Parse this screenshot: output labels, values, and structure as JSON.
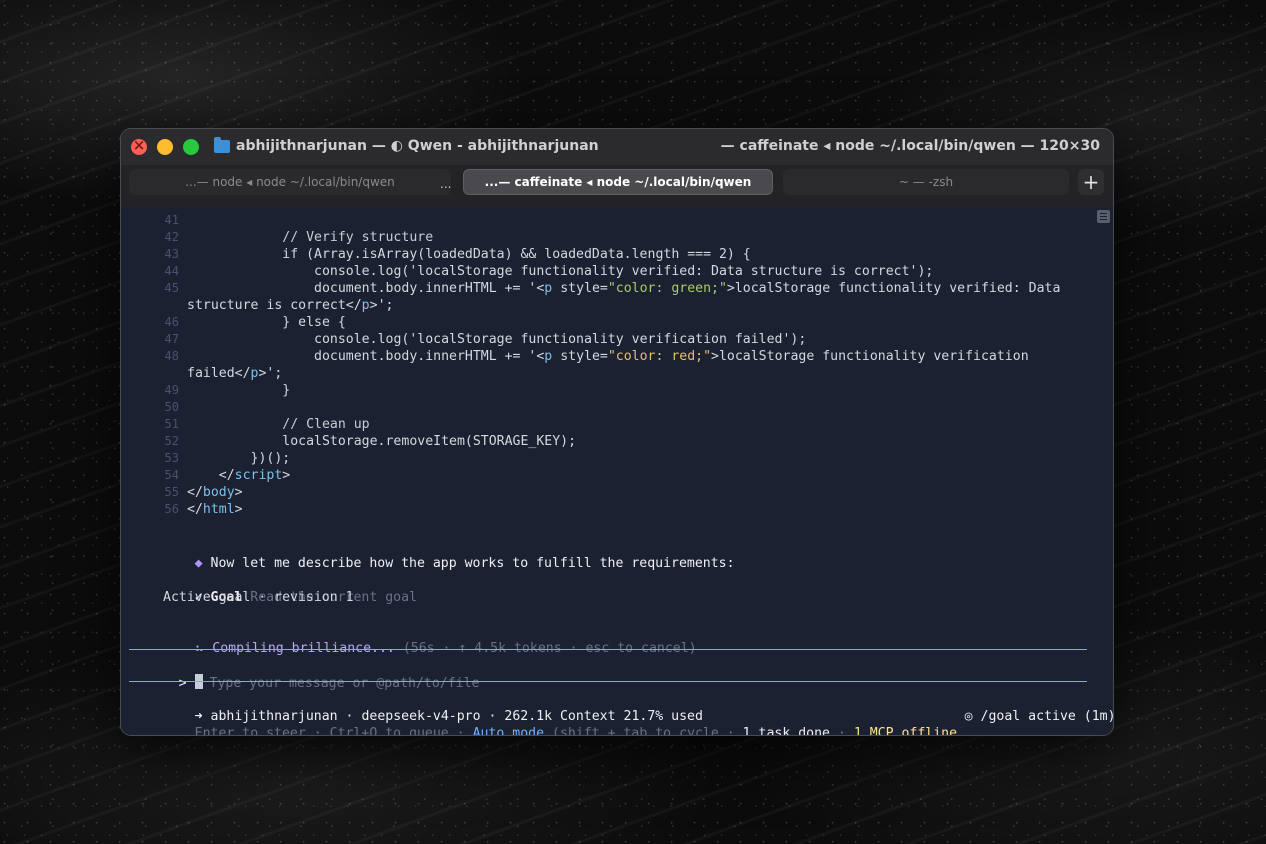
{
  "window": {
    "title_left": "abhijithnarjunan — ◐ Qwen - abhijithnarjunan",
    "title_right": "— caffeinate ◂ node ~/.local/bin/qwen — 120×30"
  },
  "tabs": [
    {
      "label": "...— node ◂ node ~/.local/bin/qwen",
      "active": false
    },
    {
      "label": "...— caffeinate ◂ node ~/.local/bin/qwen",
      "active": true
    },
    {
      "label": "~ — -zsh",
      "active": false
    }
  ],
  "tab_overflow": "...",
  "add_tab_label": "+",
  "code_lines": [
    {
      "n": "41",
      "pre": "",
      "parts": []
    },
    {
      "n": "42",
      "pre": "            ",
      "parts": [
        {
          "t": "// Verify structure",
          "c": "c-comment"
        }
      ]
    },
    {
      "n": "43",
      "pre": "            ",
      "parts": [
        {
          "t": "if (Array.isArray(loadedData) && loadedData.length === 2) {",
          "c": ""
        }
      ]
    },
    {
      "n": "44",
      "pre": "                ",
      "parts": [
        {
          "t": "console.log('localStorage functionality verified: Data structure is correct');",
          "c": ""
        }
      ]
    },
    {
      "n": "45",
      "pre": "                ",
      "parts": [
        {
          "t": "document.body.innerHTML += '<",
          "c": ""
        },
        {
          "t": "p",
          "c": "c-tag"
        },
        {
          "t": " style=",
          "c": ""
        },
        {
          "t": "\"color: green;\"",
          "c": "c-green"
        },
        {
          "t": ">localStorage functionality verified: Data",
          "c": ""
        }
      ]
    },
    {
      "n": "",
      "pre": "",
      "parts": [
        {
          "t": "structure is correct</",
          "c": ""
        },
        {
          "t": "p",
          "c": "c-tag"
        },
        {
          "t": ">';",
          "c": ""
        }
      ]
    },
    {
      "n": "46",
      "pre": "            ",
      "parts": [
        {
          "t": "} else {",
          "c": ""
        }
      ]
    },
    {
      "n": "47",
      "pre": "                ",
      "parts": [
        {
          "t": "console.log('localStorage functionality verification failed');",
          "c": ""
        }
      ]
    },
    {
      "n": "48",
      "pre": "                ",
      "parts": [
        {
          "t": "document.body.innerHTML += '<",
          "c": ""
        },
        {
          "t": "p",
          "c": "c-tag"
        },
        {
          "t": " style=",
          "c": ""
        },
        {
          "t": "\"color: red;\"",
          "c": "c-red"
        },
        {
          "t": ">localStorage functionality verification",
          "c": ""
        }
      ]
    },
    {
      "n": "",
      "pre": "",
      "parts": [
        {
          "t": "failed</",
          "c": ""
        },
        {
          "t": "p",
          "c": "c-tag"
        },
        {
          "t": ">';",
          "c": ""
        }
      ]
    },
    {
      "n": "49",
      "pre": "            ",
      "parts": [
        {
          "t": "}",
          "c": ""
        }
      ]
    },
    {
      "n": "50",
      "pre": "",
      "parts": []
    },
    {
      "n": "51",
      "pre": "            ",
      "parts": [
        {
          "t": "// Clean up",
          "c": "c-comment"
        }
      ]
    },
    {
      "n": "52",
      "pre": "            ",
      "parts": [
        {
          "t": "localStorage.removeItem(STORAGE_KEY);",
          "c": ""
        }
      ]
    },
    {
      "n": "53",
      "pre": "        ",
      "parts": [
        {
          "t": "})();",
          "c": ""
        }
      ]
    },
    {
      "n": "54",
      "pre": "    ",
      "parts": [
        {
          "t": "</",
          "c": ""
        },
        {
          "t": "script",
          "c": "c-tag"
        },
        {
          "t": ">",
          "c": ""
        }
      ]
    },
    {
      "n": "55",
      "pre": "",
      "parts": [
        {
          "t": "</",
          "c": ""
        },
        {
          "t": "body",
          "c": "c-tag"
        },
        {
          "t": ">",
          "c": ""
        }
      ]
    },
    {
      "n": "56",
      "pre": "",
      "parts": [
        {
          "t": "</",
          "c": ""
        },
        {
          "t": "html",
          "c": "c-tag"
        },
        {
          "t": ">",
          "c": ""
        }
      ]
    }
  ],
  "assistant": {
    "bullet": "◆",
    "message": "Now let me describe how the app works to fulfill the requirements:"
  },
  "goal": {
    "check": "✓",
    "label": "Goal",
    "hint": "Read the current goal",
    "status": "Active goal · revision 1"
  },
  "progress": {
    "spinner": "⠦",
    "text": "Compiling brilliance...",
    "meta": "(56s · ↑ 4.5k tokens · esc to cancel)"
  },
  "input": {
    "prompt": ">",
    "placeholder": "Type your message or @path/to/file"
  },
  "status": {
    "arrow": "➜",
    "user": "abhijithnarjunan",
    "model": "deepseek-v4-pro",
    "context": "262.1k Context 21.7% used",
    "goal_icon": "◎",
    "goal_status": "/goal active (1m)",
    "steer": "Enter to steer",
    "queue": "Ctrl+Q to queue",
    "mode": "Auto mode",
    "mode_hint": "(shift + tab to cycle",
    "tasks": "1 task done",
    "mcp": "1 MCP offline",
    "dot": "·"
  }
}
